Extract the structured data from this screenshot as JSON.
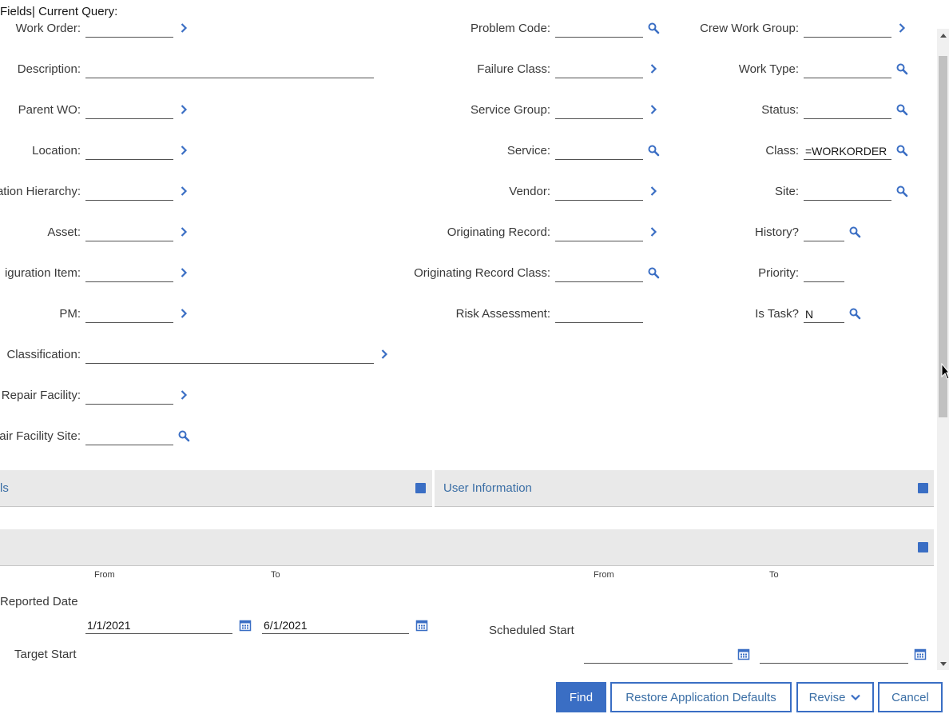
{
  "header": {
    "title": "Fields| Current Query:"
  },
  "col1": [
    {
      "label": "Work Order:",
      "value": "",
      "icon": "chevron-right-icon"
    },
    {
      "label": "Description:",
      "value": "",
      "icon": ""
    },
    {
      "label": "Parent WO:",
      "value": "",
      "icon": "chevron-right-icon"
    },
    {
      "label": "Location:",
      "value": "",
      "icon": "chevron-right-icon"
    },
    {
      "label": "ation Hierarchy:",
      "value": "",
      "icon": "chevron-right-icon"
    },
    {
      "label": "Asset:",
      "value": "",
      "icon": "chevron-right-icon"
    },
    {
      "label": "iguration Item:",
      "value": "",
      "icon": "chevron-right-icon"
    },
    {
      "label": "PM:",
      "value": "",
      "icon": "chevron-right-icon"
    },
    {
      "label": "Classification:",
      "value": "",
      "icon": "chevron-right-icon"
    },
    {
      "label": "Repair Facility:",
      "value": "",
      "icon": "chevron-right-icon"
    },
    {
      "label": "air Facility Site:",
      "value": "",
      "icon": "search-icon"
    }
  ],
  "col2": [
    {
      "label": "Problem Code:",
      "value": "",
      "icon": "search-icon"
    },
    {
      "label": "Failure Class:",
      "value": "",
      "icon": "chevron-right-icon"
    },
    {
      "label": "Service Group:",
      "value": "",
      "icon": "chevron-right-icon"
    },
    {
      "label": "Service:",
      "value": "",
      "icon": "search-icon"
    },
    {
      "label": "Vendor:",
      "value": "",
      "icon": "chevron-right-icon"
    },
    {
      "label": "Originating Record:",
      "value": "",
      "icon": "chevron-right-icon"
    },
    {
      "label": "Originating Record Class:",
      "value": "",
      "icon": "search-icon"
    },
    {
      "label": "Risk Assessment:",
      "value": "",
      "icon": ""
    }
  ],
  "col3": [
    {
      "label": "Crew Work Group:",
      "value": "",
      "icon": "chevron-right-icon"
    },
    {
      "label": "Work Type:",
      "value": "",
      "icon": "search-icon"
    },
    {
      "label": "Status:",
      "value": "",
      "icon": "search-icon"
    },
    {
      "label": "Class:",
      "value": "=WORKORDER",
      "icon": "search-icon"
    },
    {
      "label": "Site:",
      "value": "",
      "icon": "search-icon"
    },
    {
      "label": "History?",
      "value": "",
      "icon": "search-icon"
    },
    {
      "label": "Priority:",
      "value": "",
      "icon": ""
    },
    {
      "label": "Is Task?",
      "value": "N",
      "icon": "search-icon"
    }
  ],
  "sections": {
    "left_title": "ls",
    "right_title": "User Information"
  },
  "dates": {
    "from_label": "From",
    "to_label": "To",
    "reported_date_label": "Reported Date",
    "reported_from": "1/1/2021",
    "reported_to": "6/1/2021",
    "scheduled_start_label": "Scheduled Start",
    "scheduled_from": "",
    "scheduled_to": "",
    "target_start_label": "Target Start"
  },
  "buttons": {
    "find": "Find",
    "restore": "Restore Application Defaults",
    "revise": "Revise",
    "cancel": "Cancel"
  },
  "colors": {
    "accent": "#3a6ec4",
    "link": "#3a6ea5",
    "section_bg": "#e9e9e9"
  }
}
